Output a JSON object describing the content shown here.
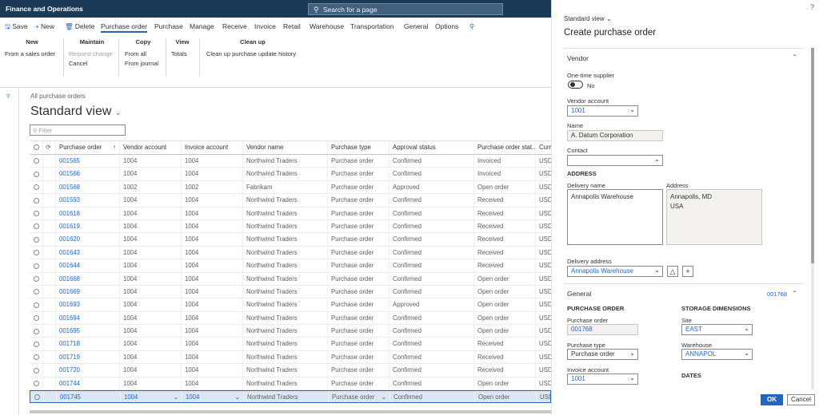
{
  "app": {
    "title": "Finance and Operations",
    "search_placeholder": "Search for a page"
  },
  "toolbar": {
    "save": "Save",
    "new": "New",
    "delete": "Delete",
    "tabs": [
      "Purchase order",
      "Purchase",
      "Manage",
      "Receive",
      "Invoice",
      "Retail",
      "Warehouse",
      "Transportation",
      "General",
      "Options"
    ]
  },
  "groups": {
    "new": {
      "header": "New",
      "items": [
        "From a sales order"
      ]
    },
    "maintain": {
      "header": "Maintain",
      "items": [
        "Request change",
        "Cancel"
      ]
    },
    "copy": {
      "header": "Copy",
      "items": [
        "From all",
        "From journal"
      ]
    },
    "view": {
      "header": "View",
      "items": [
        "Totals"
      ]
    },
    "cleanup": {
      "header": "Clean up",
      "items": [
        "Clean up purchase update history"
      ]
    }
  },
  "list": {
    "breadcrumb": "All purchase orders",
    "view_title": "Standard view",
    "filter_placeholder": "Filter",
    "columns": [
      "Purchase order",
      "Vendor account",
      "Invoice account",
      "Vendor name",
      "Purchase type",
      "Approval status",
      "Purchase order stat...",
      "Curr"
    ],
    "rows": [
      [
        "001565",
        "1004",
        "1004",
        "Northwind Traders",
        "Purchase order",
        "Confirmed",
        "Invoiced",
        "USD"
      ],
      [
        "001566",
        "1004",
        "1004",
        "Northwind Traders",
        "Purchase order",
        "Confirmed",
        "Invoiced",
        "USD"
      ],
      [
        "001568",
        "1002",
        "1002",
        "Fabrikam",
        "Purchase order",
        "Approved",
        "Open order",
        "USD"
      ],
      [
        "001593",
        "1004",
        "1004",
        "Northwind Traders",
        "Purchase order",
        "Confirmed",
        "Received",
        "USD"
      ],
      [
        "001618",
        "1004",
        "1004",
        "Northwind Traders",
        "Purchase order",
        "Confirmed",
        "Received",
        "USD"
      ],
      [
        "001619",
        "1004",
        "1004",
        "Northwind Traders",
        "Purchase order",
        "Confirmed",
        "Received",
        "USD"
      ],
      [
        "001620",
        "1004",
        "1004",
        "Northwind Traders",
        "Purchase order",
        "Confirmed",
        "Received",
        "USD"
      ],
      [
        "001643",
        "1004",
        "1004",
        "Northwind Traders",
        "Purchase order",
        "Confirmed",
        "Received",
        "USD"
      ],
      [
        "001644",
        "1004",
        "1004",
        "Northwind Traders",
        "Purchase order",
        "Confirmed",
        "Received",
        "USD"
      ],
      [
        "001668",
        "1004",
        "1004",
        "Northwind Traders",
        "Purchase order",
        "Confirmed",
        "Open order",
        "USD"
      ],
      [
        "001669",
        "1004",
        "1004",
        "Northwind Traders",
        "Purchase order",
        "Confirmed",
        "Open order",
        "USD"
      ],
      [
        "001693",
        "1004",
        "1004",
        "Northwind Traders",
        "Purchase order",
        "Approved",
        "Open order",
        "USD"
      ],
      [
        "001694",
        "1004",
        "1004",
        "Northwind Traders",
        "Purchase order",
        "Confirmed",
        "Open order",
        "USD"
      ],
      [
        "001695",
        "1004",
        "1004",
        "Northwind Traders",
        "Purchase order",
        "Confirmed",
        "Open order",
        "USD"
      ],
      [
        "001718",
        "1004",
        "1004",
        "Northwind Traders",
        "Purchase order",
        "Confirmed",
        "Received",
        "USD"
      ],
      [
        "001719",
        "1004",
        "1004",
        "Northwind Traders",
        "Purchase order",
        "Confirmed",
        "Received",
        "USD"
      ],
      [
        "001720",
        "1004",
        "1004",
        "Northwind Traders",
        "Purchase order",
        "Confirmed",
        "Received",
        "USD"
      ],
      [
        "001744",
        "1004",
        "1004",
        "Northwind Traders",
        "Purchase order",
        "Confirmed",
        "Open order",
        "USD"
      ],
      [
        "001745",
        "1004",
        "1004",
        "Northwind Traders",
        "Purchase order",
        "Confirmed",
        "Open order",
        "USD"
      ]
    ]
  },
  "panel": {
    "help": "?",
    "view": "Standard view",
    "title": "Create purchase order",
    "vendor_section": "Vendor",
    "one_time_label": "One-time supplier",
    "one_time_value": "No",
    "vendor_account_label": "Vendor account",
    "vendor_account": "1001",
    "name_label": "Name",
    "name": "A. Datum Corporation",
    "contact_label": "Contact",
    "address_header": "ADDRESS",
    "delivery_name_label": "Delivery name",
    "delivery_name": "Annapolis Warehouse",
    "address_label": "Address",
    "address_line1": "Annapolis, MD",
    "address_line2": "USA",
    "delivery_address_label": "Delivery address",
    "delivery_address": "Annapolis Warehouse",
    "general_section": "General",
    "general_summary": "001768",
    "po_header": "PURCHASE ORDER",
    "po_label": "Purchase order",
    "po_value": "001768",
    "ptype_label": "Purchase type",
    "ptype_value": "Purchase order",
    "invoice_label": "Invoice account",
    "invoice_value": "1001",
    "storage_header": "STORAGE DIMENSIONS",
    "site_label": "Site",
    "site_value": "EAST",
    "warehouse_label": "Warehouse",
    "warehouse_value": "ANNAPOL",
    "dates_header": "DATES",
    "ok": "OK",
    "cancel": "Cancel"
  }
}
